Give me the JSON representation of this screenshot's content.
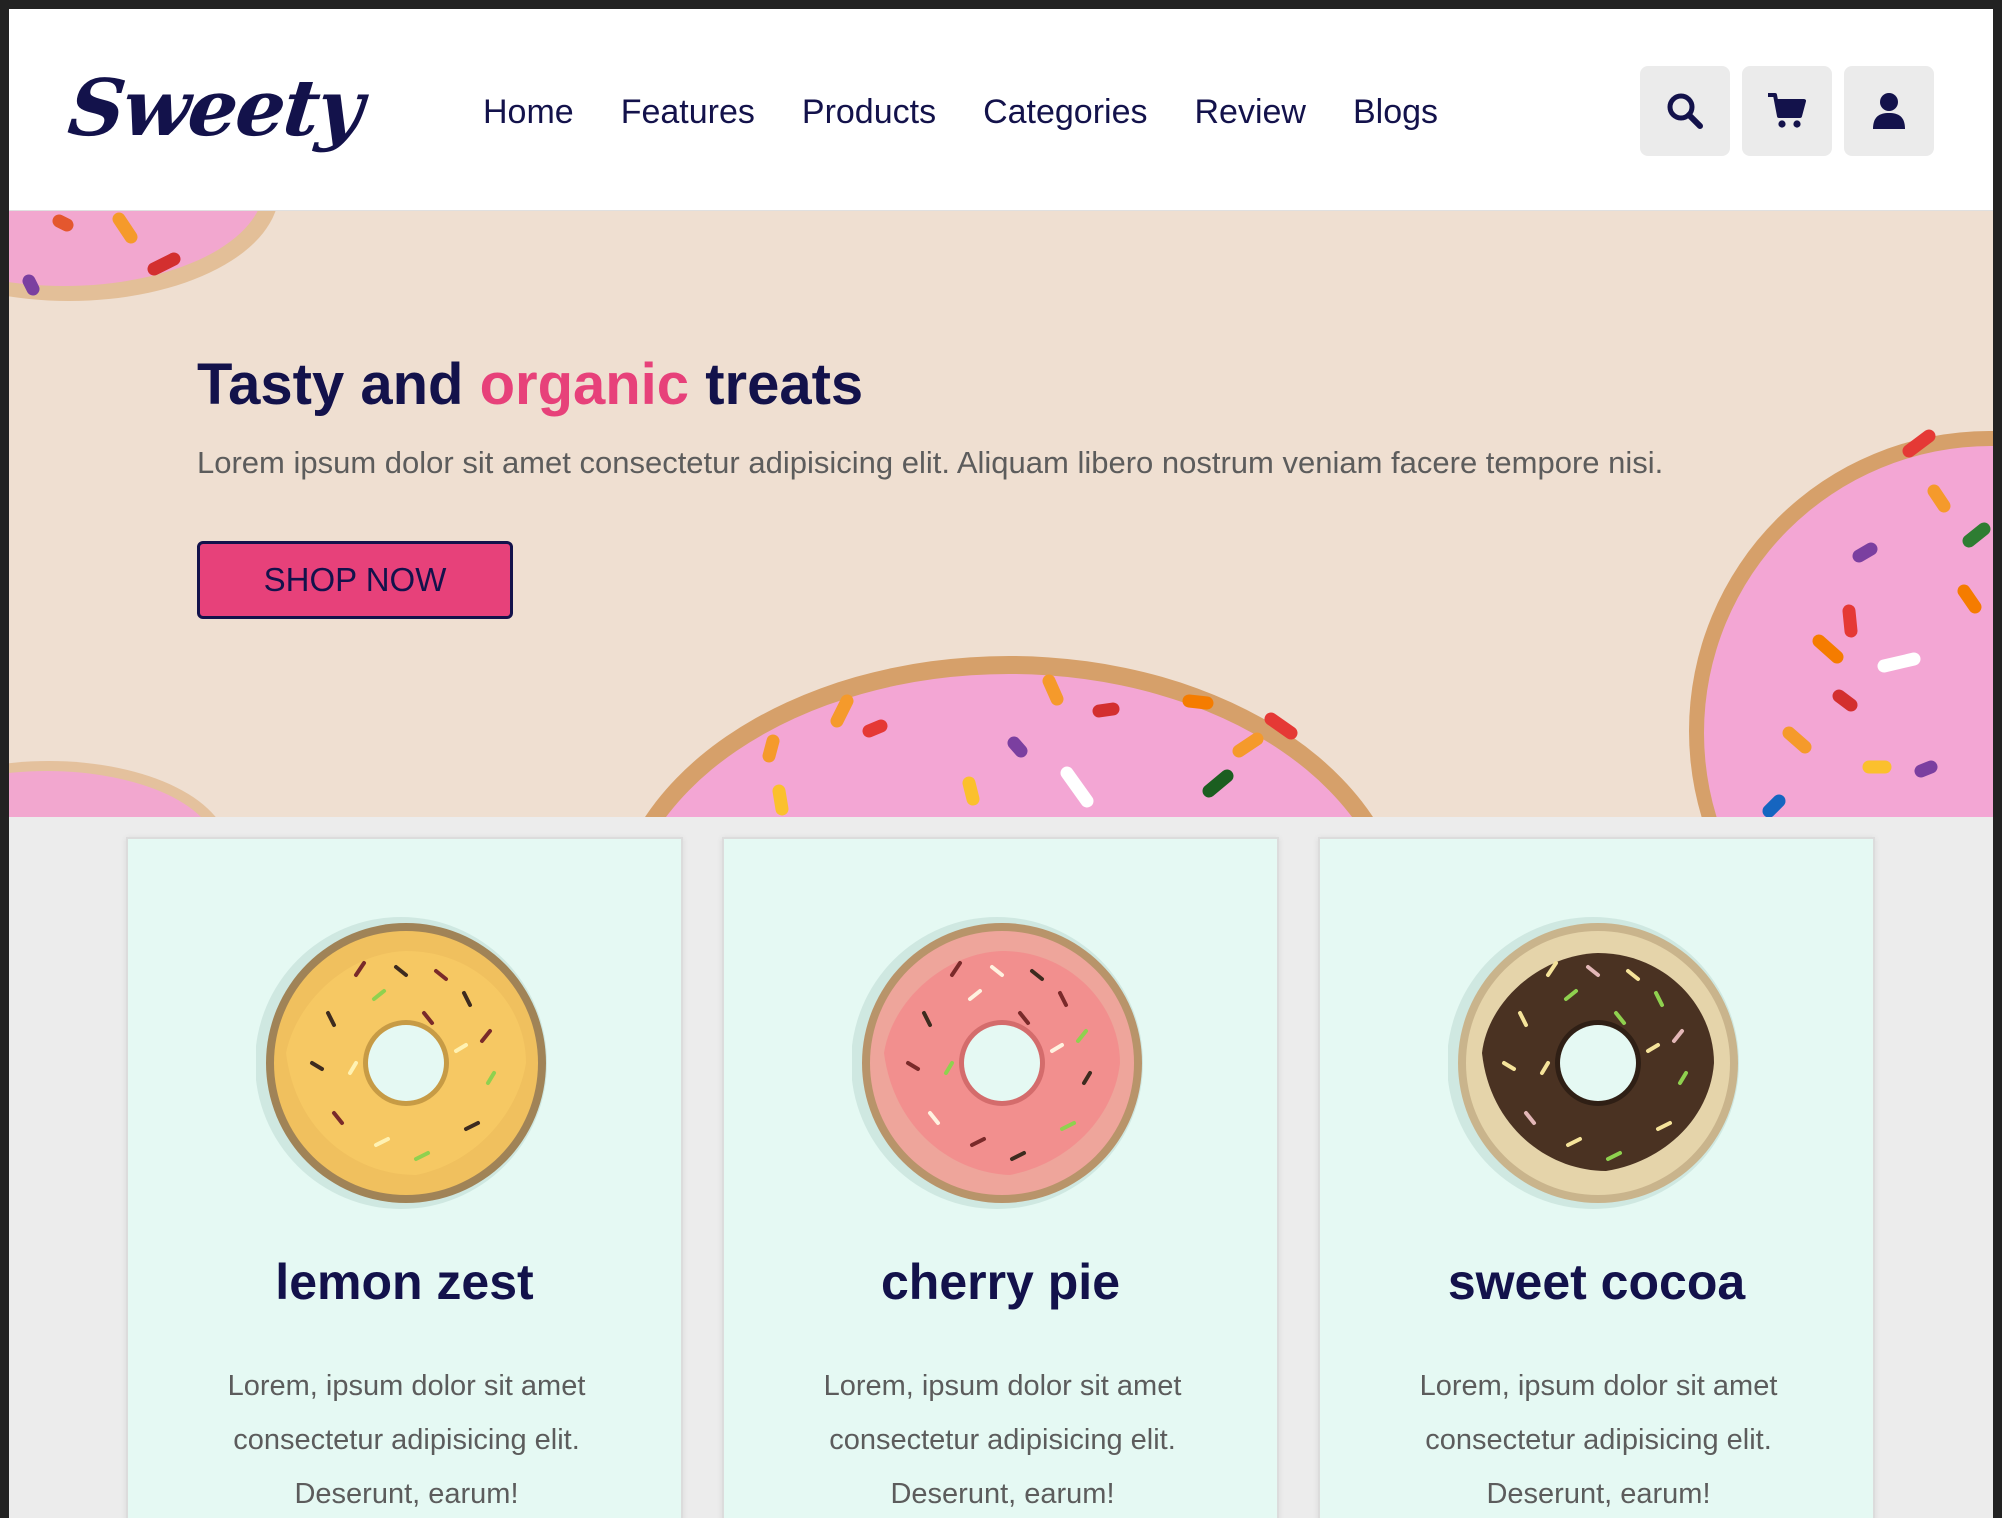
{
  "brand": {
    "logo": "Sweety"
  },
  "nav": {
    "items": [
      {
        "label": "Home"
      },
      {
        "label": "Features"
      },
      {
        "label": "Products"
      },
      {
        "label": "Categories"
      },
      {
        "label": "Review"
      },
      {
        "label": "Blogs"
      }
    ]
  },
  "header_icons": [
    "search-icon",
    "cart-icon",
    "user-icon"
  ],
  "hero": {
    "title_prefix": "Tasty and",
    "title_accent": "organic",
    "title_suffix": "treats",
    "text": "Lorem ipsum dolor sit amet consectetur adipisicing elit. Aliquam libero nostrum veniam facere tempore nisi.",
    "button_label": "SHOP NOW"
  },
  "products": [
    {
      "name": "lemon zest",
      "description": "Lorem, ipsum dolor sit amet consectetur adipisicing elit. Deserunt, earum!",
      "icing": "yellow"
    },
    {
      "name": "cherry pie",
      "description": "Lorem, ipsum dolor sit amet consectetur adipisicing elit. Deserunt, earum!",
      "icing": "pink"
    },
    {
      "name": "sweet cocoa",
      "description": "Lorem, ipsum dolor sit amet consectetur adipisicing elit. Deserunt, earum!",
      "icing": "chocolate"
    }
  ],
  "colors": {
    "brand_dark": "#13124b",
    "accent_pink": "#e7417a",
    "hero_bg": "#efdfd1",
    "card_bg": "#e5f9f3",
    "page_bg": "#ececec",
    "icon_button_bg": "#ebebeb"
  }
}
